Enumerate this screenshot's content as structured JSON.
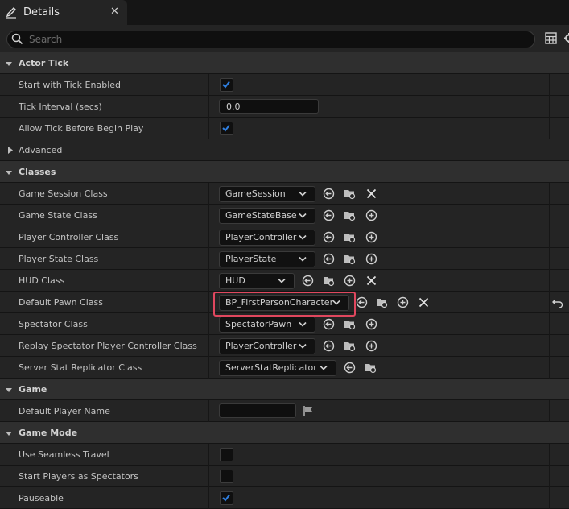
{
  "tab": {
    "title": "Details"
  },
  "search": {
    "placeholder": "Search"
  },
  "categories": {
    "actor_tick": "Actor Tick",
    "classes": "Classes",
    "game": "Game",
    "game_mode": "Game Mode"
  },
  "actor_tick": {
    "start_with_tick_enabled": {
      "label": "Start with Tick Enabled",
      "checked": true
    },
    "tick_interval": {
      "label": "Tick Interval (secs)",
      "value": "0.0"
    },
    "allow_tick_before_begin_play": {
      "label": "Allow Tick Before Begin Play",
      "checked": true
    },
    "advanced": {
      "label": "Advanced"
    }
  },
  "classes": {
    "game_session": {
      "label": "Game Session Class",
      "value": "GameSession"
    },
    "game_state": {
      "label": "Game State Class",
      "value": "GameStateBase"
    },
    "player_controller": {
      "label": "Player Controller Class",
      "value": "PlayerController"
    },
    "player_state": {
      "label": "Player State Class",
      "value": "PlayerState"
    },
    "hud": {
      "label": "HUD Class",
      "value": "HUD"
    },
    "default_pawn": {
      "label": "Default Pawn Class",
      "value": "BP_FirstPersonCharacter"
    },
    "spectator": {
      "label": "Spectator Class",
      "value": "SpectatorPawn"
    },
    "replay_spectator_pc": {
      "label": "Replay Spectator Player Controller Class",
      "value": "PlayerController"
    },
    "server_stat_replicator": {
      "label": "Server Stat Replicator Class",
      "value": "ServerStatReplicator"
    }
  },
  "game": {
    "default_player_name": {
      "label": "Default Player Name",
      "value": ""
    }
  },
  "game_mode": {
    "use_seamless_travel": {
      "label": "Use Seamless Travel",
      "checked": false
    },
    "start_players_as_spectators": {
      "label": "Start Players as Spectators",
      "checked": false
    },
    "pauseable": {
      "label": "Pauseable",
      "checked": true
    }
  },
  "colors": {
    "accent_check": "#2f7fe0",
    "highlight": "#e0475e"
  }
}
